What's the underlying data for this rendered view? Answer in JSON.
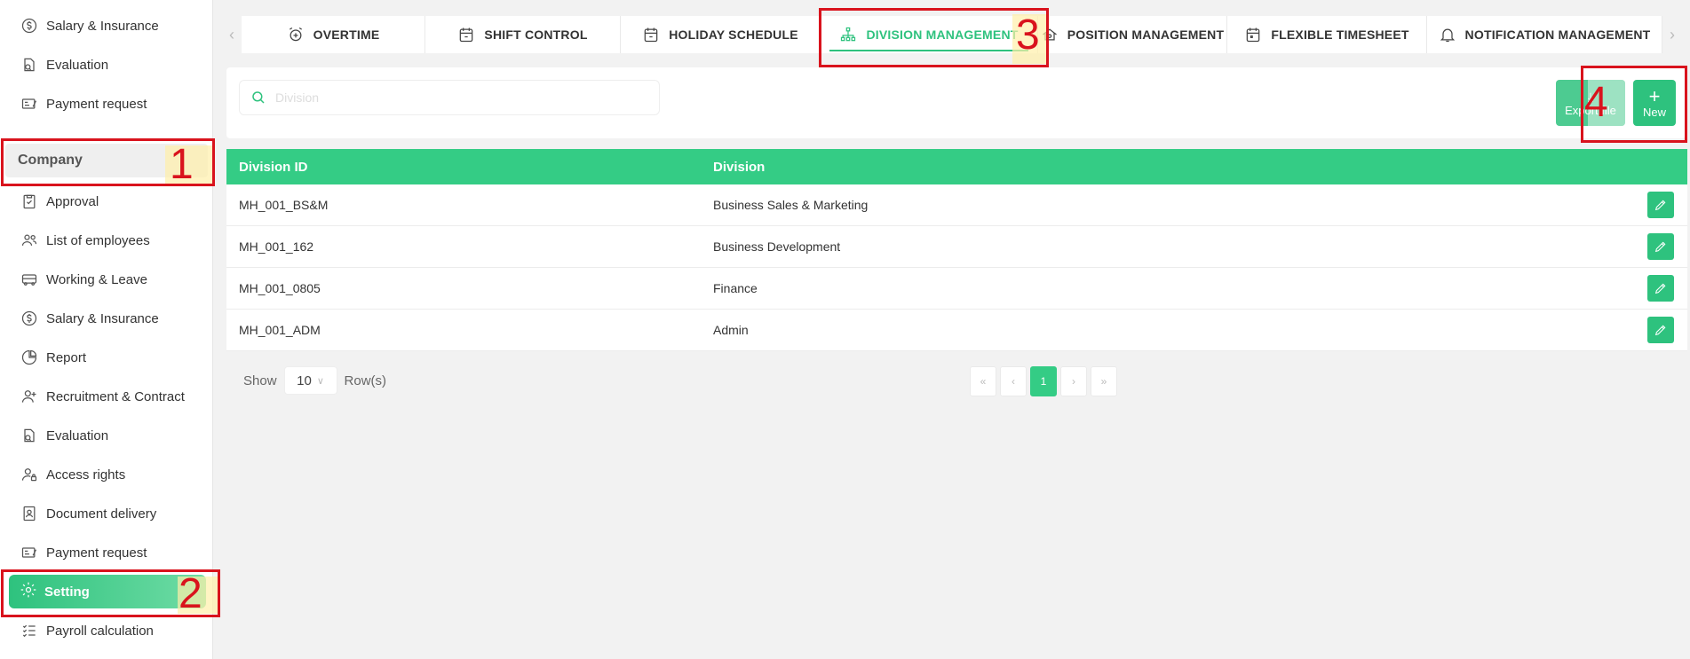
{
  "sidebar": {
    "items_top": [
      {
        "label": "Salary & Insurance",
        "icon": "dollar-circle-icon"
      },
      {
        "label": "Evaluation",
        "icon": "evaluation-icon"
      },
      {
        "label": "Payment request",
        "icon": "payment-icon"
      }
    ],
    "section": "Company",
    "items": [
      {
        "label": "Approval",
        "icon": "clipboard-check-icon"
      },
      {
        "label": "List of employees",
        "icon": "users-icon"
      },
      {
        "label": "Working & Leave",
        "icon": "bus-icon"
      },
      {
        "label": "Salary & Insurance",
        "icon": "dollar-circle-icon"
      },
      {
        "label": "Report",
        "icon": "pie-chart-icon"
      },
      {
        "label": "Recruitment & Contract",
        "icon": "user-plus-icon"
      },
      {
        "label": "Evaluation",
        "icon": "evaluation-icon"
      },
      {
        "label": "Access rights",
        "icon": "user-lock-icon"
      },
      {
        "label": "Document delivery",
        "icon": "id-card-icon"
      },
      {
        "label": "Payment request",
        "icon": "payment-icon"
      }
    ],
    "active": "Setting",
    "after": {
      "label": "Payroll calculation",
      "icon": "checklist-icon"
    }
  },
  "tabs": [
    {
      "label": "OVERTIME",
      "icon": "alarm-plus-icon"
    },
    {
      "label": "SHIFT CONTROL",
      "icon": "calendar-icon"
    },
    {
      "label": "HOLIDAY SCHEDULE",
      "icon": "calendar-icon"
    },
    {
      "label": "DIVISION MANAGEMENT",
      "icon": "org-chart-icon",
      "active": true
    },
    {
      "label": "POSITION MANAGEMENT",
      "icon": "position-icon"
    },
    {
      "label": "FLEXIBLE TIMESHEET",
      "icon": "calendar-icon"
    },
    {
      "label": "NOTIFICATION MANAGEMENT",
      "icon": "bell-icon"
    }
  ],
  "toolbar": {
    "search_placeholder": "Division",
    "export_label": "Export file",
    "new_label": "New",
    "new_symbol": "+"
  },
  "table": {
    "headers": [
      "Division ID",
      "Division"
    ],
    "rows": [
      {
        "id": "MH_001_BS&M",
        "division": "Business Sales & Marketing"
      },
      {
        "id": "MH_001_162",
        "division": "Business Development"
      },
      {
        "id": "MH_001_0805",
        "division": "Finance"
      },
      {
        "id": "MH_001_ADM",
        "division": "Admin"
      }
    ]
  },
  "footer": {
    "show_label": "Show",
    "rows_value": "10",
    "rows_label": "Row(s)",
    "pager": {
      "first": "«",
      "prev": "‹",
      "current": "1",
      "next": "›",
      "last": "»"
    }
  },
  "annotations": [
    "1",
    "2",
    "3",
    "4"
  ],
  "colors": {
    "accent": "#2ec27e",
    "header": "#34cc85",
    "annotation": "#d9131d"
  }
}
